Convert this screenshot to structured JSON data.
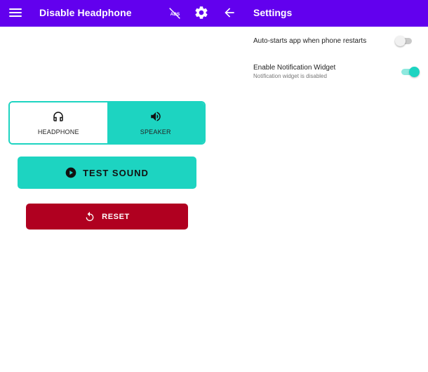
{
  "appbar": {
    "left_title": "Disable Headphone",
    "right_title": "Settings",
    "background": "#6200ee",
    "icons": [
      "menu-icon",
      "ads-off-icon",
      "gear-icon",
      "back-arrow-icon"
    ]
  },
  "audio_output": {
    "options": [
      {
        "label": "HEADPHONE",
        "icon": "headphones-icon",
        "selected": true
      },
      {
        "label": "SPEAKER",
        "icon": "speaker-icon",
        "selected": false
      }
    ],
    "accent": "#1dd4c1"
  },
  "test_sound": {
    "label": "TEST SOUND",
    "icon": "play-circle-icon",
    "color": "#1dd4c1"
  },
  "reset": {
    "label": "RESET",
    "icon": "restart-icon",
    "color": "#b00020"
  },
  "settings": [
    {
      "title": "Auto-starts app when phone restarts",
      "subtitle": "",
      "enabled": false
    },
    {
      "title": "Enable Notification Widget",
      "subtitle": "Notification widget is disabled",
      "enabled": true
    }
  ]
}
